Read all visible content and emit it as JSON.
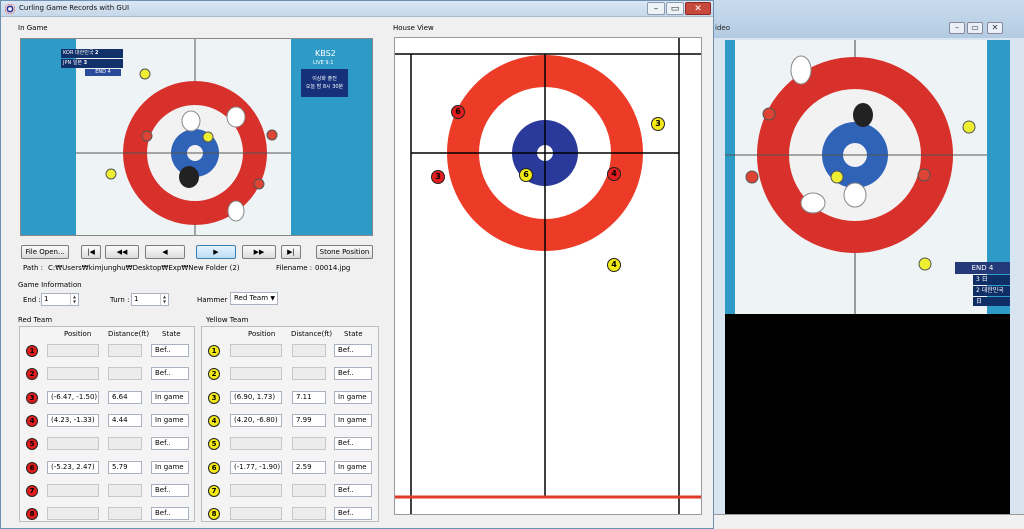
{
  "video_window": {
    "title": "ideo",
    "min_label": "–",
    "restore_label": "▭",
    "close_label": "✕",
    "scoreboard": {
      "end": "END 4",
      "row1_score": "3",
      "row1_team": "日",
      "row2_score": "2",
      "row2_team": "대한민국",
      "sub": "日"
    }
  },
  "main_window": {
    "title": "Curling Game Records with GUI",
    "min_label": "–",
    "max_label": "▭",
    "close_label": "✕"
  },
  "in_game": {
    "label": "In Game",
    "broadcast": {
      "kor_code": "KOR",
      "kor_name": "대한민국",
      "kor_score": "2",
      "jpn_code": "JPN",
      "jpn_name": "일본",
      "jpn_score": "3",
      "end": "END 4",
      "channel": "KBS2",
      "channel_sub": "LIVE 9.1",
      "promo_line1": "이상화 출전",
      "promo_line2": "오늘 밤 8시 30분"
    }
  },
  "controls": {
    "file_open": "File Open...",
    "first": "|◀",
    "prev_fast": "◀◀",
    "prev": "◀",
    "play": "▶",
    "next_fast": "▶▶",
    "last": "▶|",
    "stone_position": "Stone Position"
  },
  "path": {
    "label": "Path :",
    "value": "C:₩Users₩kimjunghu₩Desktop₩Exp₩New Folder (2)",
    "filename_label": "Filename :",
    "filename": "00014.jpg"
  },
  "game_info": {
    "label": "Game Information",
    "end_label": "End :",
    "end_value": "1",
    "turn_label": "Turn :",
    "turn_value": "1",
    "hammer_label": "Hammer :",
    "hammer_value": "Red Team"
  },
  "red_team": {
    "label": "Red Team",
    "col_position": "Position",
    "col_distance": "Distance(ft)",
    "col_state": "State",
    "rows": [
      {
        "n": "1",
        "position": "",
        "distance": "",
        "state": "Bef.."
      },
      {
        "n": "2",
        "position": "",
        "distance": "",
        "state": "Bef.."
      },
      {
        "n": "3",
        "position": "(-6.47, -1.50)",
        "distance": "6.64",
        "state": "In game"
      },
      {
        "n": "4",
        "position": "(4.23, -1.33)",
        "distance": "4.44",
        "state": "In game"
      },
      {
        "n": "5",
        "position": "",
        "distance": "",
        "state": "Bef.."
      },
      {
        "n": "6",
        "position": "(-5.23, 2.47)",
        "distance": "5.79",
        "state": "In game"
      },
      {
        "n": "7",
        "position": "",
        "distance": "",
        "state": "Bef.."
      },
      {
        "n": "8",
        "position": "",
        "distance": "",
        "state": "Bef.."
      }
    ]
  },
  "yellow_team": {
    "label": "Yellow Team",
    "col_position": "Position",
    "col_distance": "Distance(ft)",
    "col_state": "State",
    "rows": [
      {
        "n": "1",
        "position": "",
        "distance": "",
        "state": "Bef.."
      },
      {
        "n": "2",
        "position": "",
        "distance": "",
        "state": "Bef.."
      },
      {
        "n": "3",
        "position": "(6.90, 1.73)",
        "distance": "7.11",
        "state": "In game"
      },
      {
        "n": "4",
        "position": "(4.20, -6.80)",
        "distance": "7.99",
        "state": "In game"
      },
      {
        "n": "5",
        "position": "",
        "distance": "",
        "state": "Bef.."
      },
      {
        "n": "6",
        "position": "(-1.77, -1.90)",
        "distance": "2.59",
        "state": "In game"
      },
      {
        "n": "7",
        "position": "",
        "distance": "",
        "state": "Bef.."
      },
      {
        "n": "8",
        "position": "",
        "distance": "",
        "state": "Bef.."
      }
    ]
  },
  "house_view": {
    "label": "House View",
    "stones": [
      {
        "team": "red",
        "n": "6"
      },
      {
        "team": "red",
        "n": "3"
      },
      {
        "team": "red",
        "n": "4"
      },
      {
        "team": "yellow",
        "n": "3"
      },
      {
        "team": "yellow",
        "n": "6"
      },
      {
        "team": "yellow",
        "n": "4"
      }
    ]
  },
  "colors": {
    "red_stone": "#e21d1d",
    "yellow_stone": "#f4ea17",
    "ring_red": "#ec3b27",
    "ring_blue": "#2a3a9a",
    "ice_blue": "#2e9bc6"
  }
}
